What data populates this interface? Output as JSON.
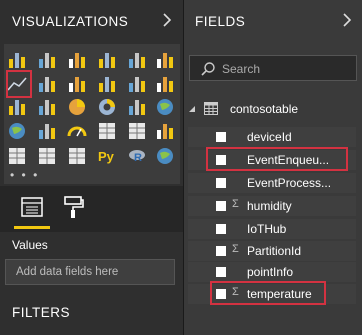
{
  "visualizations": {
    "title": "VISUALIZATIONS",
    "more": "• • •"
  },
  "fields_pane": {
    "title": "FIELDS",
    "search_placeholder": "Search"
  },
  "values": {
    "label": "Values",
    "placeholder": "Add data fields here"
  },
  "filters": {
    "title": "FILTERS"
  },
  "table": {
    "name": "contosotable"
  },
  "fields": [
    {
      "name": "deviceId",
      "sigma": ""
    },
    {
      "name": "EventEnqueu...",
      "sigma": ""
    },
    {
      "name": "EventProcess...",
      "sigma": ""
    },
    {
      "name": "humidity",
      "sigma": "Σ"
    },
    {
      "name": "IoTHub",
      "sigma": ""
    },
    {
      "name": "PartitionId",
      "sigma": "Σ"
    },
    {
      "name": "pointInfo",
      "sigma": ""
    },
    {
      "name": "temperature",
      "sigma": "Σ"
    }
  ],
  "viz_icons": [
    "stacked-bar-icon",
    "stacked-column-icon",
    "clustered-bar-icon",
    "clustered-column-icon",
    "100-percent-bar-icon",
    "100-percent-column-icon",
    "line-chart-icon",
    "area-chart-icon",
    "stacked-area-icon",
    "line-column-icon",
    "line-clustered-column-icon",
    "ribbon-chart-icon",
    "waterfall-icon",
    "scatter-icon",
    "pie-chart-icon",
    "donut-chart-icon",
    "treemap-icon",
    "map-icon",
    "filled-map-icon",
    "funnel-icon",
    "gauge-icon",
    "card-icon",
    "multi-row-card-icon",
    "kpi-icon",
    "slicer-icon",
    "table-icon",
    "matrix-icon",
    "python-visual-icon",
    "r-visual-icon",
    "arcgis-icon"
  ],
  "colors": {
    "highlight": "#d33241",
    "accent": "#f2c811"
  }
}
